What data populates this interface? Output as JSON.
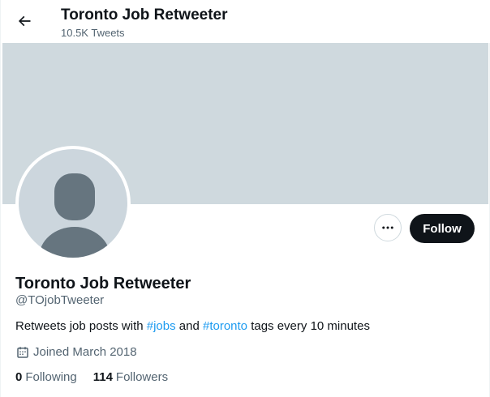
{
  "header": {
    "back_icon": "arrow-left-icon",
    "title": "Toronto Job Retweeter",
    "tweet_count": "10.5K Tweets"
  },
  "profile": {
    "display_name": "Toronto Job Retweeter",
    "handle": "@TOjobTweeter",
    "bio": {
      "part1": "Retweets job posts with ",
      "hashtag1": "#jobs",
      "part2": " and ",
      "hashtag2": "#toronto",
      "part3": " tags every 10 minutes"
    },
    "joined": "Joined March 2018",
    "joined_icon": "calendar-icon",
    "following_count": "0",
    "following_label": "Following",
    "followers_count": "114",
    "followers_label": "Followers"
  },
  "actions": {
    "more_icon": "more-dots-icon",
    "follow_label": "Follow"
  },
  "colors": {
    "banner": "#cfd9de",
    "avatar_bg": "#ccd6dd",
    "avatar_figure": "#66757f",
    "link": "#1d9bf0",
    "follow_bg": "#0f1419",
    "secondary_text": "#536471"
  }
}
